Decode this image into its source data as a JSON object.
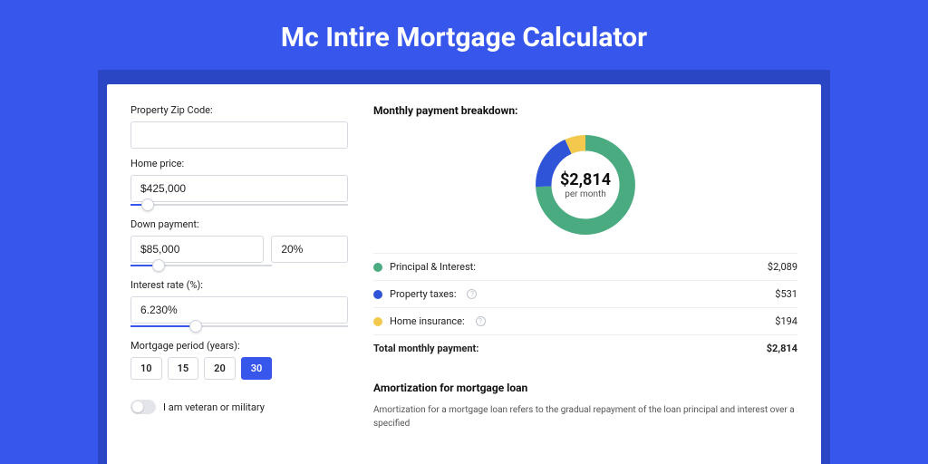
{
  "title": "Mc Intire Mortgage Calculator",
  "form": {
    "zip_label": "Property Zip Code:",
    "zip_value": "",
    "price_label": "Home price:",
    "price_value": "$425,000",
    "down_label": "Down payment:",
    "down_amount": "$85,000",
    "down_percent": "20%",
    "rate_label": "Interest rate (%):",
    "rate_value": "6.230%",
    "period_label": "Mortgage period (years):",
    "periods": [
      "10",
      "15",
      "20",
      "30"
    ],
    "period_active": "30",
    "veteran_label": "I am veteran or military"
  },
  "breakdown": {
    "title": "Monthly payment breakdown:",
    "center_value": "$2,814",
    "center_sub": "per month",
    "items": [
      {
        "label": "Principal & Interest:",
        "value": "$2,089",
        "color": "#4aab80",
        "info": false
      },
      {
        "label": "Property taxes:",
        "value": "$531",
        "color": "#2f54d8",
        "info": true
      },
      {
        "label": "Home insurance:",
        "value": "$194",
        "color": "#f2c94c",
        "info": true
      }
    ],
    "total_label": "Total monthly payment:",
    "total_value": "$2,814"
  },
  "amort": {
    "title": "Amortization for mortgage loan",
    "text": "Amortization for a mortgage loan refers to the gradual repayment of the loan principal and interest over a specified"
  },
  "chart_data": {
    "type": "pie",
    "title": "Monthly payment breakdown",
    "series": [
      {
        "name": "Principal & Interest",
        "value": 2089,
        "color": "#4aab80"
      },
      {
        "name": "Property taxes",
        "value": 531,
        "color": "#2f54d8"
      },
      {
        "name": "Home insurance",
        "value": 194,
        "color": "#f2c94c"
      }
    ],
    "total": 2814,
    "center_label": "$2,814 per month"
  }
}
